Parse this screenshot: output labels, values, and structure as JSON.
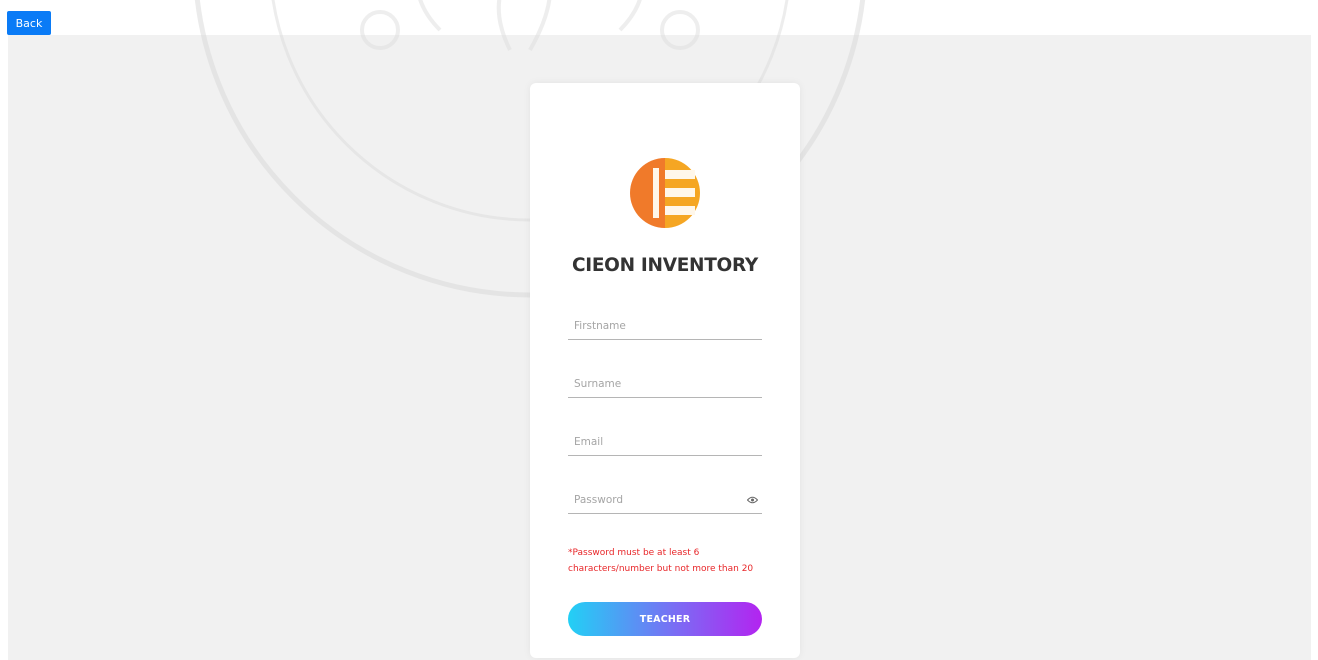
{
  "header": {
    "back_label": "Back"
  },
  "form": {
    "title": "CIEON INVENTORY",
    "firstname_placeholder": "Firstname",
    "surname_placeholder": "Surname",
    "email_placeholder": "Email",
    "password_placeholder": "Password",
    "password_note": "*Password must be at least 6 characters/number but not more than 20",
    "submit_label": "TEACHER"
  },
  "colors": {
    "accent_blue": "#0a7bf6",
    "error_red": "#e8272a",
    "logo_orange": "#f07a2a",
    "logo_yellow": "#f5a623",
    "gradient_start": "#22d0f5",
    "gradient_end": "#b324f0"
  },
  "icons": {
    "password_toggle": "eye-icon",
    "brand": "cieon-logo"
  }
}
